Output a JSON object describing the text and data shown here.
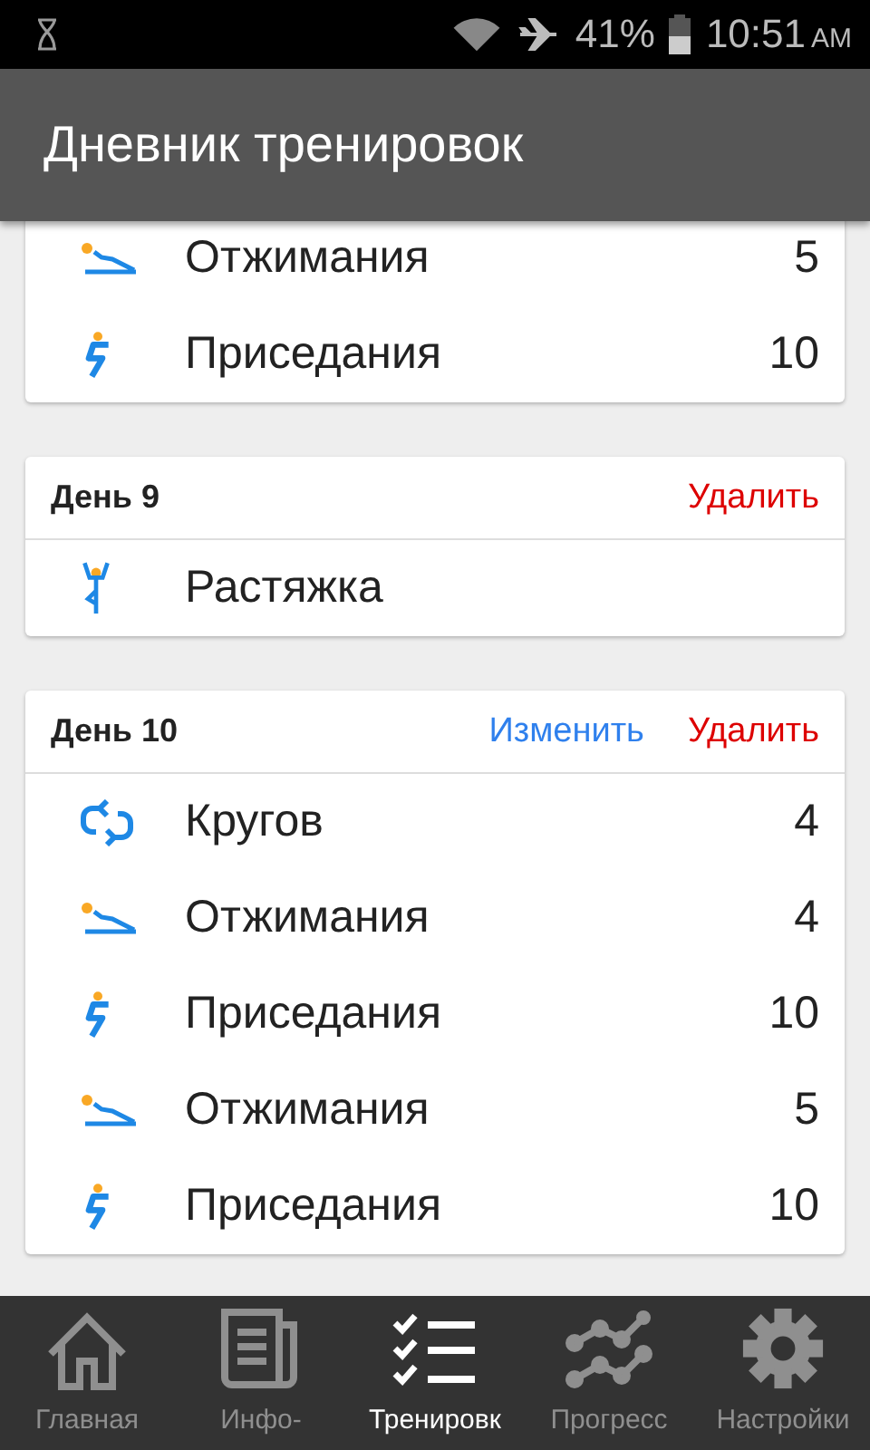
{
  "status_bar": {
    "battery": "41%",
    "time": "10:51",
    "meridiem": "AM"
  },
  "app_bar": {
    "title": "Дневник тренировок"
  },
  "cards": [
    {
      "exercises": [
        {
          "kind": "pushup",
          "name": "Отжимания",
          "count": "5"
        },
        {
          "kind": "squat",
          "name": "Приседания",
          "count": "10"
        }
      ]
    },
    {
      "title": "День 9",
      "actions": [
        {
          "kind": "delete",
          "label": "Удалить"
        }
      ],
      "exercises": [
        {
          "kind": "stretch",
          "name": "Растяжка"
        }
      ]
    },
    {
      "title": "День 10",
      "actions": [
        {
          "kind": "edit",
          "label": "Изменить"
        },
        {
          "kind": "delete",
          "label": "Удалить"
        }
      ],
      "exercises": [
        {
          "kind": "laps",
          "name": "Кругов",
          "count": "4"
        },
        {
          "kind": "pushup",
          "name": "Отжимания",
          "count": "4"
        },
        {
          "kind": "squat",
          "name": "Приседания",
          "count": "10"
        },
        {
          "kind": "pushup",
          "name": "Отжимания",
          "count": "5"
        },
        {
          "kind": "squat",
          "name": "Приседания",
          "count": "10"
        }
      ]
    }
  ],
  "nav": [
    {
      "label": "Главная",
      "selected": false
    },
    {
      "label": "Инфо-",
      "selected": false
    },
    {
      "label": "Тренировк",
      "selected": true
    },
    {
      "label": "Прогресс",
      "selected": false
    },
    {
      "label": "Настройки",
      "selected": false
    }
  ]
}
